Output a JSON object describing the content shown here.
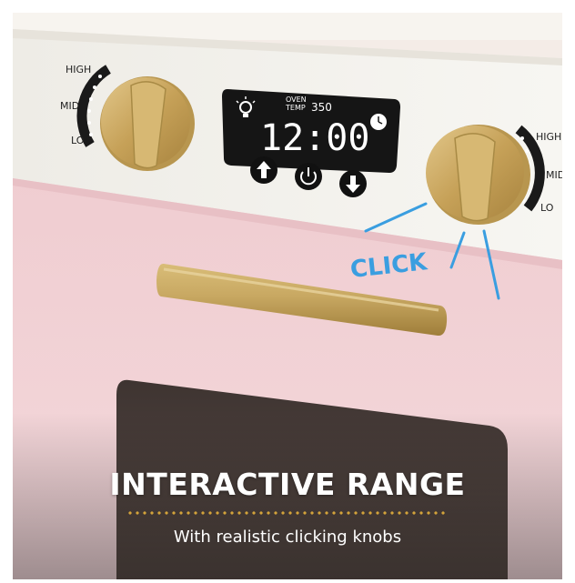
{
  "knob_labels_left": {
    "high": "HIGH",
    "mid": "MID",
    "lo": "LO"
  },
  "knob_labels_right": {
    "high": "HIGH",
    "mid": "MID",
    "lo": "LO"
  },
  "display": {
    "oven_label_1": "OVEN",
    "oven_label_2": "TEMP",
    "temperature": "350",
    "time": "12:00"
  },
  "click_label": "CLICK",
  "caption": {
    "title": "INTERACTIVE RANGE",
    "subtitle": "With realistic clicking knobs"
  },
  "colors": {
    "pink": "#f2d2d5",
    "white_panel": "#f3f1ec",
    "gold": "#c9a75a",
    "glass": "#4a3e3a",
    "accent_blue": "#3a9ee0",
    "dot_gold": "#d4a33a"
  },
  "icons": [
    "light-bulb-icon",
    "clock-icon",
    "up-arrow-icon",
    "power-icon",
    "down-arrow-icon"
  ]
}
